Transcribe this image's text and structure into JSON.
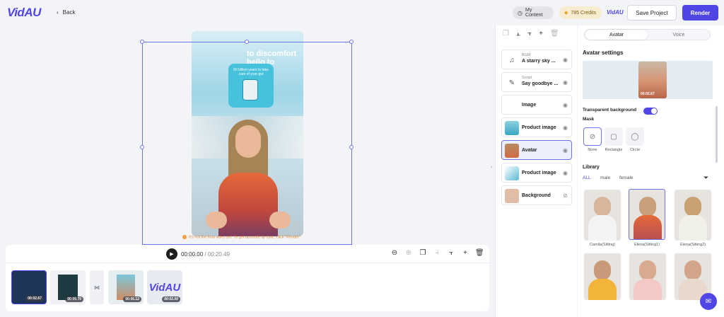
{
  "header": {
    "logo": "VidAU",
    "back_label": "Back",
    "my_content_label": "My Content",
    "credits_label": "785 Credits",
    "mini_logo": "VidAU",
    "save_label": "Save Project",
    "render_label": "Render"
  },
  "canvas": {
    "video_text": "to discomfort hello to",
    "card_text": "60 billion years to take care of your gut",
    "warning": "It's not the final video yet. To get accurate lip sync, click \"Render\"."
  },
  "timeline": {
    "current_time": "00:00.00",
    "total_time": "/ 00:20.49",
    "clips": [
      {
        "duration": "00:02.67"
      },
      {
        "duration": "00:09.70"
      },
      {
        "duration": "00:06.12"
      },
      {
        "duration": "00:02.00",
        "label": "VidAU"
      }
    ]
  },
  "layers": [
    {
      "sub": "BGM",
      "label": "A starry sky ...",
      "icon": "music-note-icon"
    },
    {
      "sub": "Script",
      "label": "Say goodbye ...",
      "icon": "script-icon"
    },
    {
      "label": "Image",
      "icon": "none"
    },
    {
      "label": "Product image",
      "icon": "thumbnail"
    },
    {
      "label": "Avatar",
      "icon": "thumbnail",
      "active": true
    },
    {
      "label": "Product image",
      "icon": "thumbnail"
    },
    {
      "label": "Background",
      "icon": "swatch"
    }
  ],
  "right_panel": {
    "tabs": [
      "Avatar",
      "Voice"
    ],
    "section_title": "Avatar settings",
    "preview_duration": "00:02.67",
    "transparent_bg_label": "Transparent background",
    "mask_title": "Mask",
    "mask_options": [
      "None",
      "Rectangle",
      "Circle"
    ],
    "library_title": "Library",
    "filters": [
      "ALL",
      "male",
      "female"
    ],
    "library": [
      {
        "name": "Camila(Sitting)"
      },
      {
        "name": "Elena(Sitting1)"
      },
      {
        "name": "Elena(Sitting2)"
      }
    ]
  },
  "colors": {
    "accent": "#4f46e5",
    "warning": "#e8831f"
  }
}
